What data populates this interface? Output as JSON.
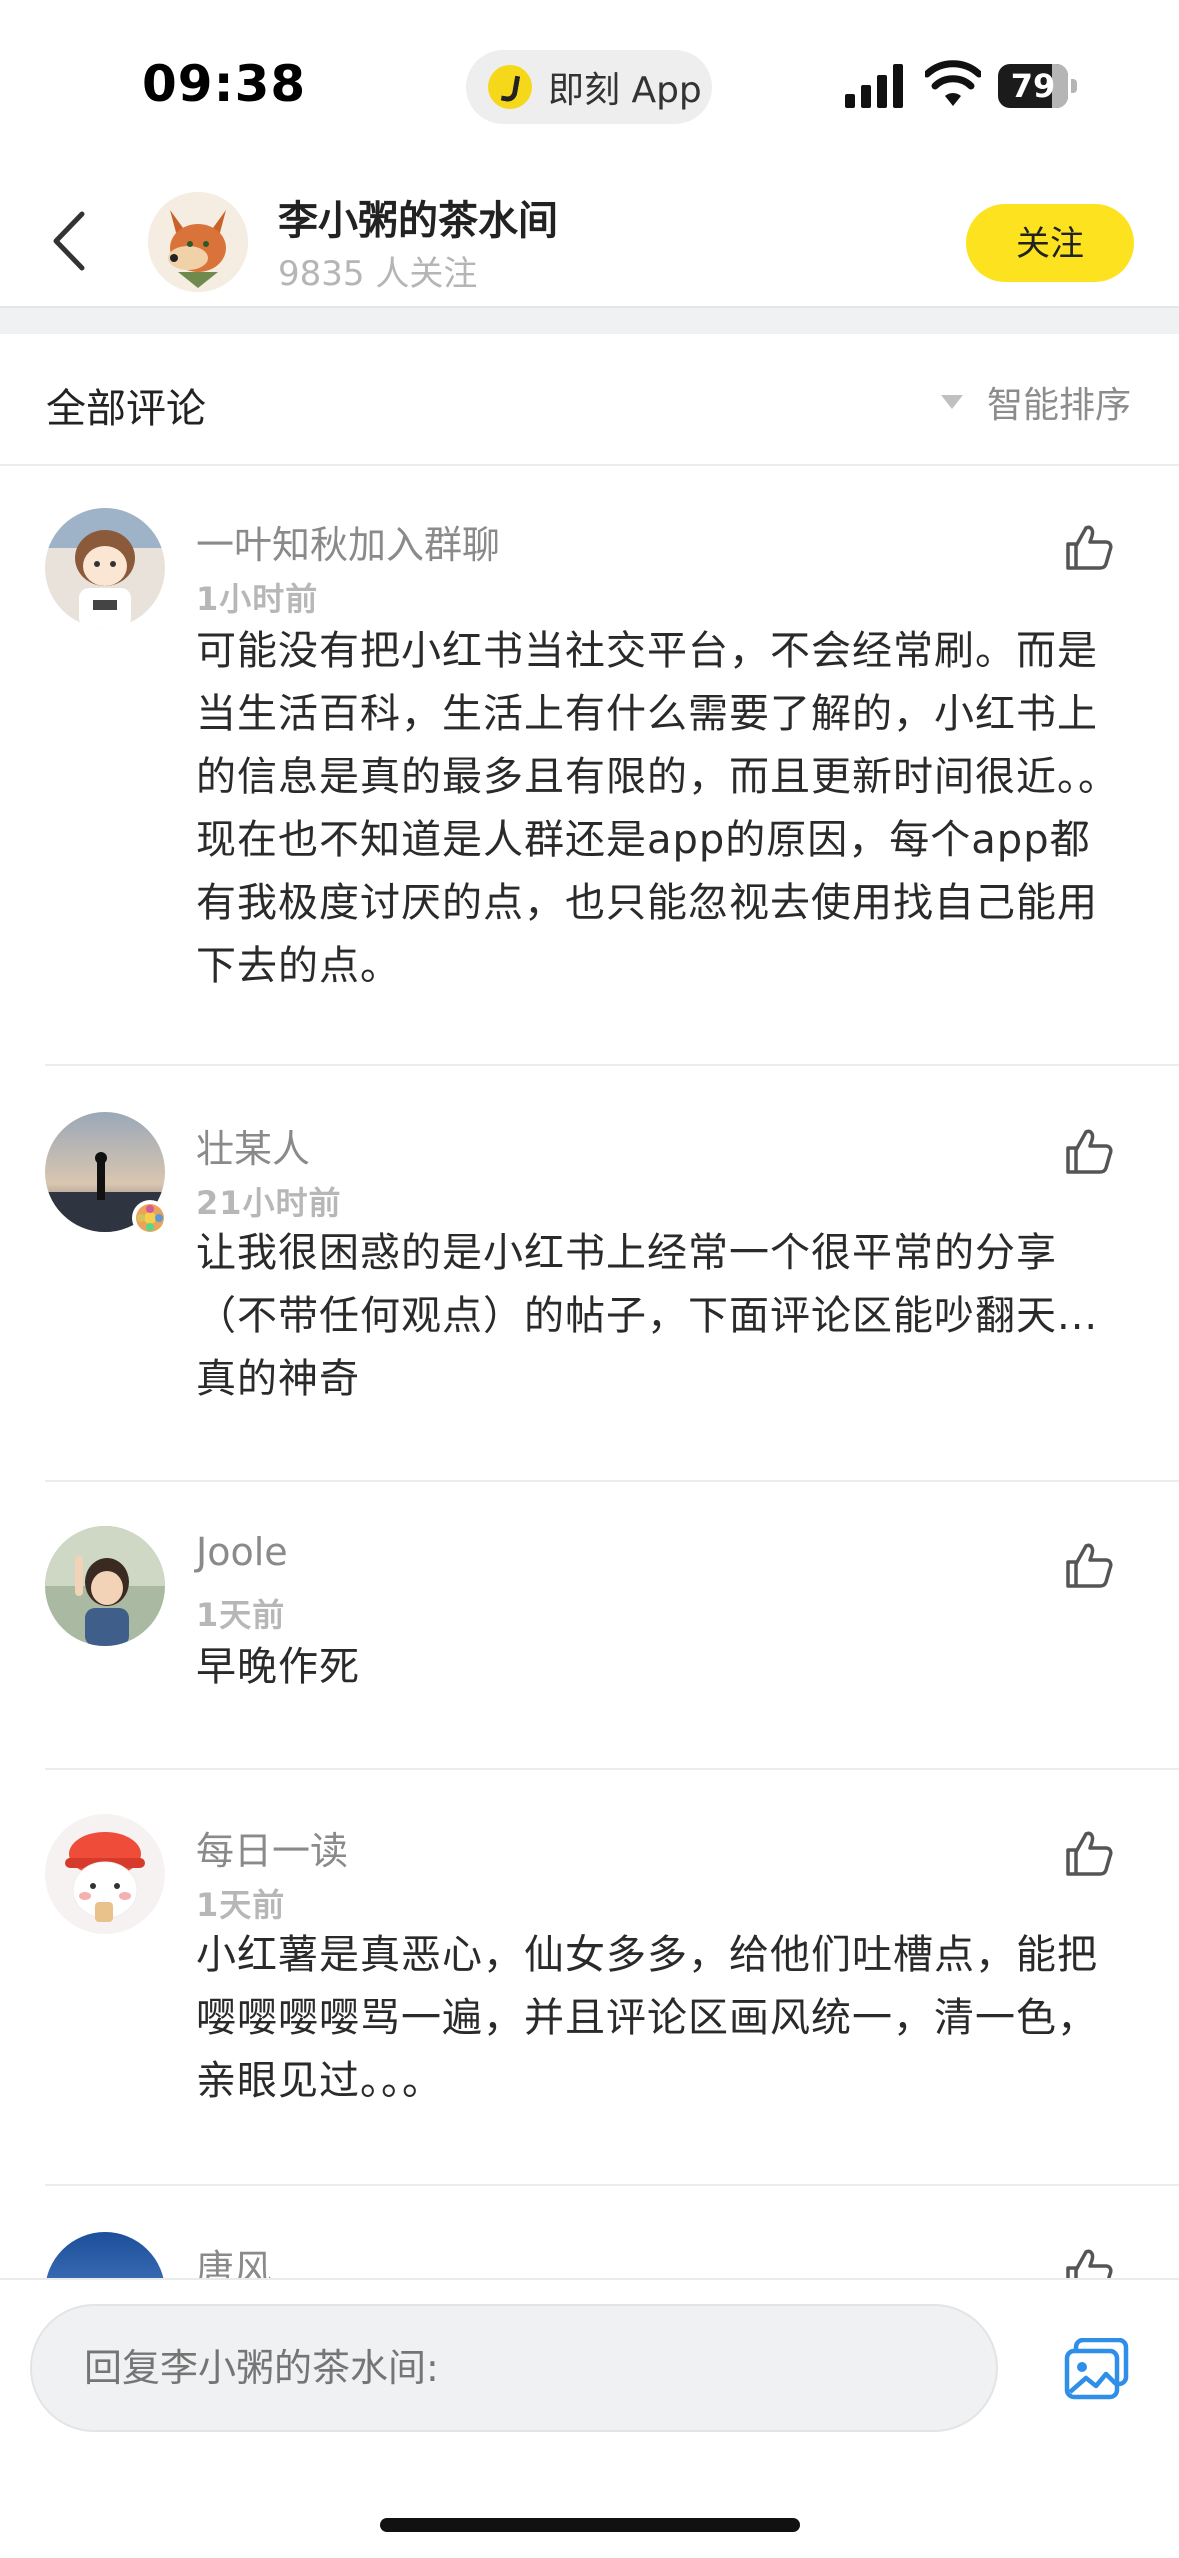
{
  "status_bar": {
    "time": "09:38",
    "app_pill": "即刻 App",
    "battery": "79"
  },
  "header": {
    "title": "李小粥的茶水间",
    "followers": "9835 人关注",
    "follow_label": "关注"
  },
  "comments_header": {
    "title": "全部评论",
    "sort_label": "智能排序"
  },
  "comments": [
    {
      "name": "一叶知秋加入群聊",
      "time": "1小时前",
      "text": "可能没有把小红书当社交平台，不会经常刷。而是当生活百科，生活上有什么需要了解的，小红书上的信息是真的最多且有限的，而且更新时间很近。。现在也不知道是人群还是app的原因，每个app都有我极度讨厌的点，也只能忽视去使用找自己能用下去的点。"
    },
    {
      "name": "壮某人",
      "time": "21小时前",
      "text": "让我很困惑的是小红书上经常一个很平常的分享（不带任何观点）的帖子，下面评论区能吵翻天...真的神奇"
    },
    {
      "name": "Joole",
      "time": "1天前",
      "text": "早晚作死"
    },
    {
      "name": "每日一读",
      "time": "1天前",
      "text": "小红薯是真恶心，仙女多多，给他们吐槽点，能把嘤嘤嘤嘤骂一遍，并且评论区画风统一，清一色，亲眼见过。。。"
    },
    {
      "name": "唐风",
      "time": "",
      "text": ""
    }
  ],
  "reply": {
    "placeholder": "回复李小粥的茶水间:"
  },
  "colors": {
    "accent_yellow": "#fde31f",
    "link_blue": "#2f8fe8"
  }
}
